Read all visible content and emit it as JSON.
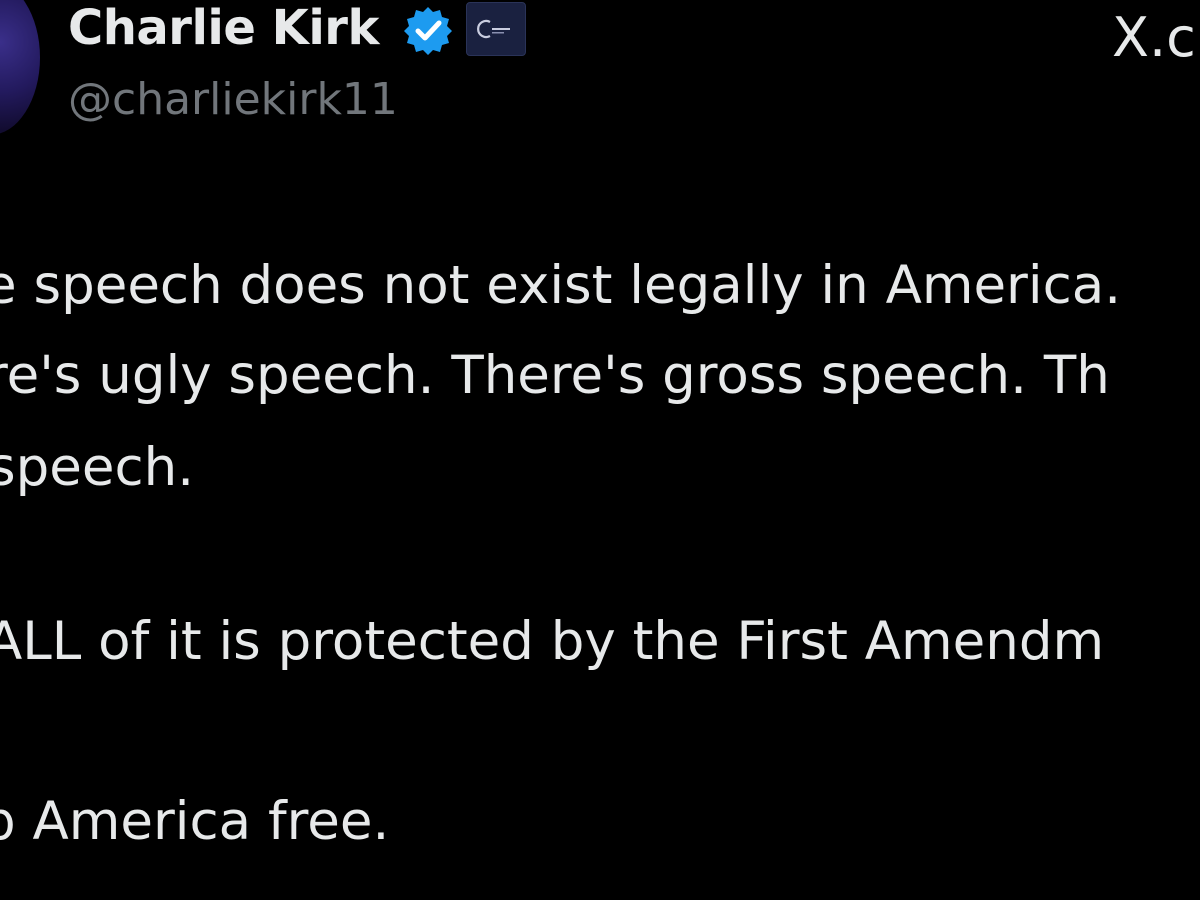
{
  "colors": {
    "background": "#000000",
    "text": "#e7e9ea",
    "handle": "#71767b",
    "verified_badge": "#1d9bf0",
    "affiliation_badge": "#1a2140"
  },
  "author": {
    "display_name": "Charlie Kirk",
    "handle": "@charliekirk11",
    "verified_icon": "verified-badge-icon",
    "affiliation_icon": "affiliation-badge-icon",
    "avatar_icon": "avatar"
  },
  "platform": {
    "logo_text": "X.c"
  },
  "tweet": {
    "lines": [
      "e speech does not exist legally in America.",
      "re's ugly speech. There's gross speech. Th",
      "speech.",
      "ALL of it is protected by the First Amendm",
      "p America free."
    ]
  }
}
